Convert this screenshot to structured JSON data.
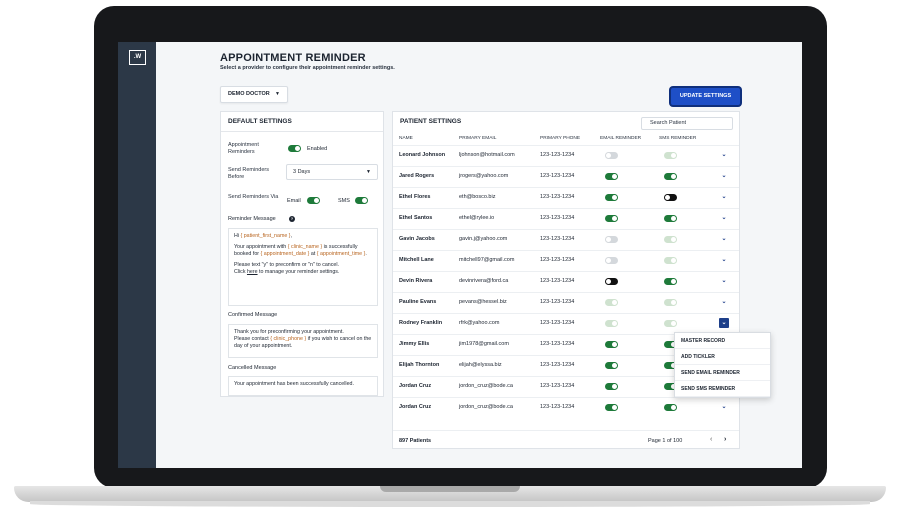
{
  "app": {
    "logo_text": ".W",
    "page_title": "APPOINTMENT REMINDER",
    "page_subtitle": "Select a provider to configure their appointment reminder settings.",
    "provider_select_value": "DEMO DOCTOR",
    "update_button": "UPDATE SETTINGS",
    "accent_color": "#1e4fc7",
    "toggle_on_color": "#1e7a3a"
  },
  "default_settings": {
    "title": "DEFAULT SETTINGS",
    "appointment_reminders_label": "Appointment Reminders",
    "appointment_reminders_state": "Enabled",
    "send_before_label": "Send Reminders Before",
    "send_before_value": "3 Days",
    "send_via_label": "Send Reminders Via",
    "email_label": "Email",
    "sms_label": "SMS",
    "reminder_message_label": "Reminder Message",
    "reminder_message": {
      "greeting_prefix": "Hi ",
      "greeting_var": "{ patient_first_name }",
      "greeting_suffix": ",",
      "line1_prefix": "Your appointment with ",
      "line1_var1": "{ clinic_name }",
      "line1_mid": " is successfully booked for ",
      "line1_var2": "{ appointment_date }",
      "line1_at": " at ",
      "line1_var3": "{ appointment_time }",
      "line1_end": ".",
      "line2": "Please text \"y\" to preconfirm or \"n\" to cancel.",
      "line3_prefix": "Click ",
      "line3_link": "here",
      "line3_suffix": " to manage your reminder settings."
    },
    "confirmed_message_label": "Confirmed Message",
    "confirmed_message": {
      "line1": "Thank you for preconfirming your appointment.",
      "prefix": "Please contact ",
      "var": "{ clinic_phone }",
      "suffix": " if you wish to cancel on the day of your appointment."
    },
    "cancelled_message_label": "Cancelled Message",
    "cancelled_message": "Your appointment has been successfully cancelled."
  },
  "patient_settings": {
    "title": "PATIENT SETTINGS",
    "search_placeholder": "Search Patient",
    "columns": [
      "NAME",
      "PRIMARY EMAIL",
      "PRIMARY PHONE",
      "EMAIL REMINDER",
      "SMS REMINDER"
    ],
    "rows": [
      {
        "name": "Leonard Johnson",
        "email": "ljohnson@hotmail.com",
        "phone": "123-123-1234",
        "email_reminder": "disabled",
        "sms_reminder": "disabled-on"
      },
      {
        "name": "Jared Rogers",
        "email": "jrogers@yahoo.com",
        "phone": "123-123-1234",
        "email_reminder": "on",
        "sms_reminder": "on"
      },
      {
        "name": "Ethel Flores",
        "email": "eth@bosco.biz",
        "phone": "123-123-1234",
        "email_reminder": "on",
        "sms_reminder": "off"
      },
      {
        "name": "Ethel Santos",
        "email": "ethel@rylee.io",
        "phone": "123-123-1234",
        "email_reminder": "on",
        "sms_reminder": "on"
      },
      {
        "name": "Gavin Jacobs",
        "email": "gavin.j@yahoo.com",
        "phone": "123-123-1234",
        "email_reminder": "disabled",
        "sms_reminder": "disabled-on"
      },
      {
        "name": "Mitchell Lane",
        "email": "mitchell97@gmail.com",
        "phone": "123-123-1234",
        "email_reminder": "disabled",
        "sms_reminder": "disabled-on"
      },
      {
        "name": "Devin Rivera",
        "email": "devinrivera@ford.ca",
        "phone": "123-123-1234",
        "email_reminder": "off",
        "sms_reminder": "on"
      },
      {
        "name": "Pauline Evans",
        "email": "pevans@hessel.biz",
        "phone": "123-123-1234",
        "email_reminder": "disabled-on",
        "sms_reminder": "disabled-on"
      },
      {
        "name": "Rodney Franklin",
        "email": "rfrk@yahoo.com",
        "phone": "123-123-1234",
        "email_reminder": "disabled-on",
        "sms_reminder": "disabled-on"
      },
      {
        "name": "Jimmy Ellis",
        "email": "jim1978@gmail.com",
        "phone": "123-123-1234",
        "email_reminder": "on",
        "sms_reminder": "on"
      },
      {
        "name": "Elijah Thornton",
        "email": "elijah@elyssa.biz",
        "phone": "123-123-1234",
        "email_reminder": "on",
        "sms_reminder": "on"
      },
      {
        "name": "Jordan Cruz",
        "email": "jordon_cruz@bode.ca",
        "phone": "123-123-1234",
        "email_reminder": "on",
        "sms_reminder": "on"
      },
      {
        "name": "Jordan Cruz",
        "email": "jordon_cruz@bode.ca",
        "phone": "123-123-1234",
        "email_reminder": "on",
        "sms_reminder": "on"
      }
    ],
    "active_row_index": 8,
    "row_menu": [
      "MASTER RECORD",
      "ADD TICKLER",
      "SEND EMAIL REMINDER",
      "SEND SMS REMINDER"
    ],
    "patients_count": "897 Patients",
    "page_info": "Page 1 of 100",
    "prev_icon": "chevron-left-icon",
    "next_icon": "chevron-right-icon"
  }
}
